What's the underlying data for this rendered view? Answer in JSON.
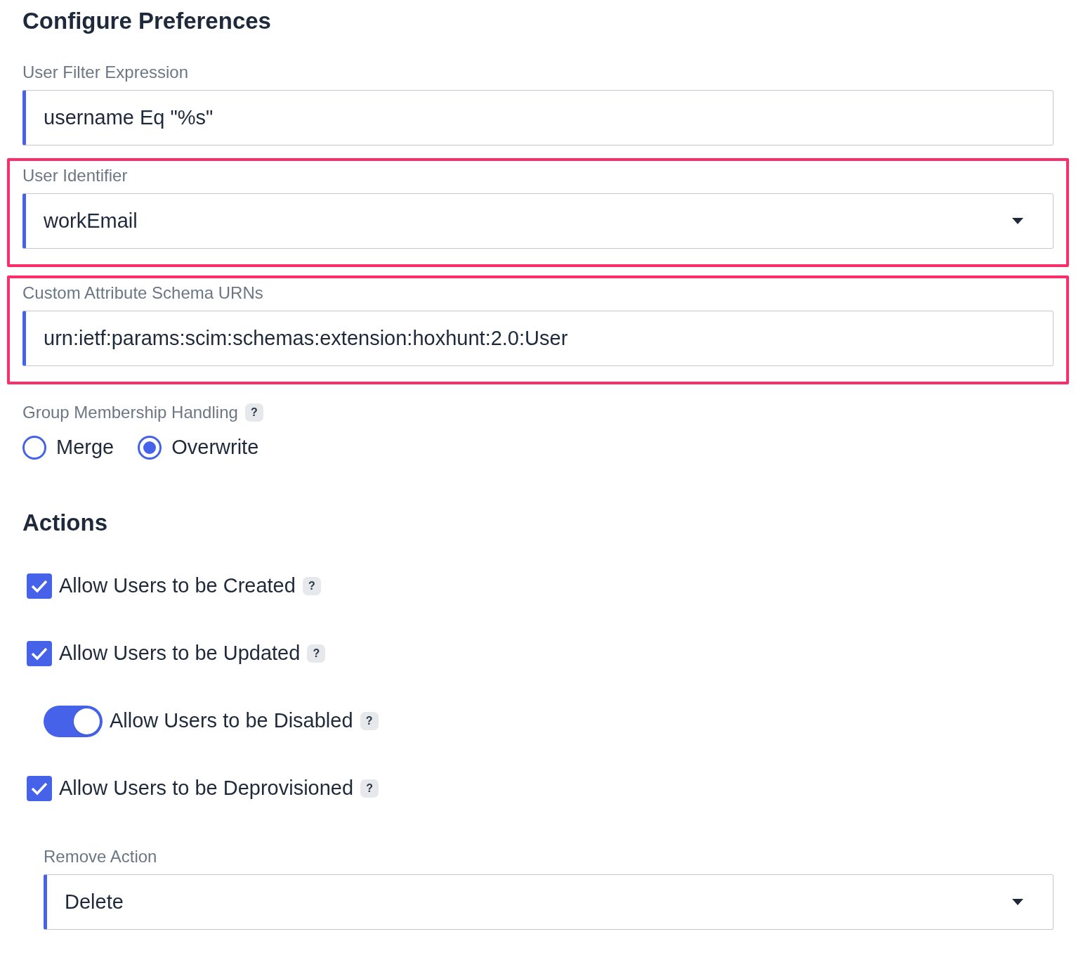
{
  "title": "Configure Preferences",
  "fields": [
    {
      "kind": "text",
      "label": "User Filter Expression",
      "value": "username Eq \"%s\"",
      "highlighted": false
    },
    {
      "kind": "select",
      "label": "User Identifier",
      "value": "workEmail",
      "highlighted": true
    },
    {
      "kind": "text",
      "label": "Custom Attribute Schema URNs",
      "value": "urn:ietf:params:scim:schemas:extension:hoxhunt:2.0:User",
      "highlighted": true
    }
  ],
  "group_membership": {
    "label": "Group Membership Handling",
    "help": "?",
    "options": [
      {
        "label": "Merge",
        "selected": false
      },
      {
        "label": "Overwrite",
        "selected": true
      }
    ]
  },
  "actions": {
    "title": "Actions",
    "items": [
      {
        "kind": "checkbox",
        "label": "Allow Users to be Created",
        "help": "?",
        "checked": true
      },
      {
        "kind": "checkbox",
        "label": "Allow Users to be Updated",
        "help": "?",
        "checked": true
      },
      {
        "kind": "toggle",
        "label": "Allow Users to be Disabled",
        "help": "?",
        "on": true
      },
      {
        "kind": "checkbox",
        "label": "Allow Users to be Deprovisioned",
        "help": "?",
        "checked": true
      }
    ]
  },
  "remove_action": {
    "label": "Remove Action",
    "value": "Delete"
  }
}
